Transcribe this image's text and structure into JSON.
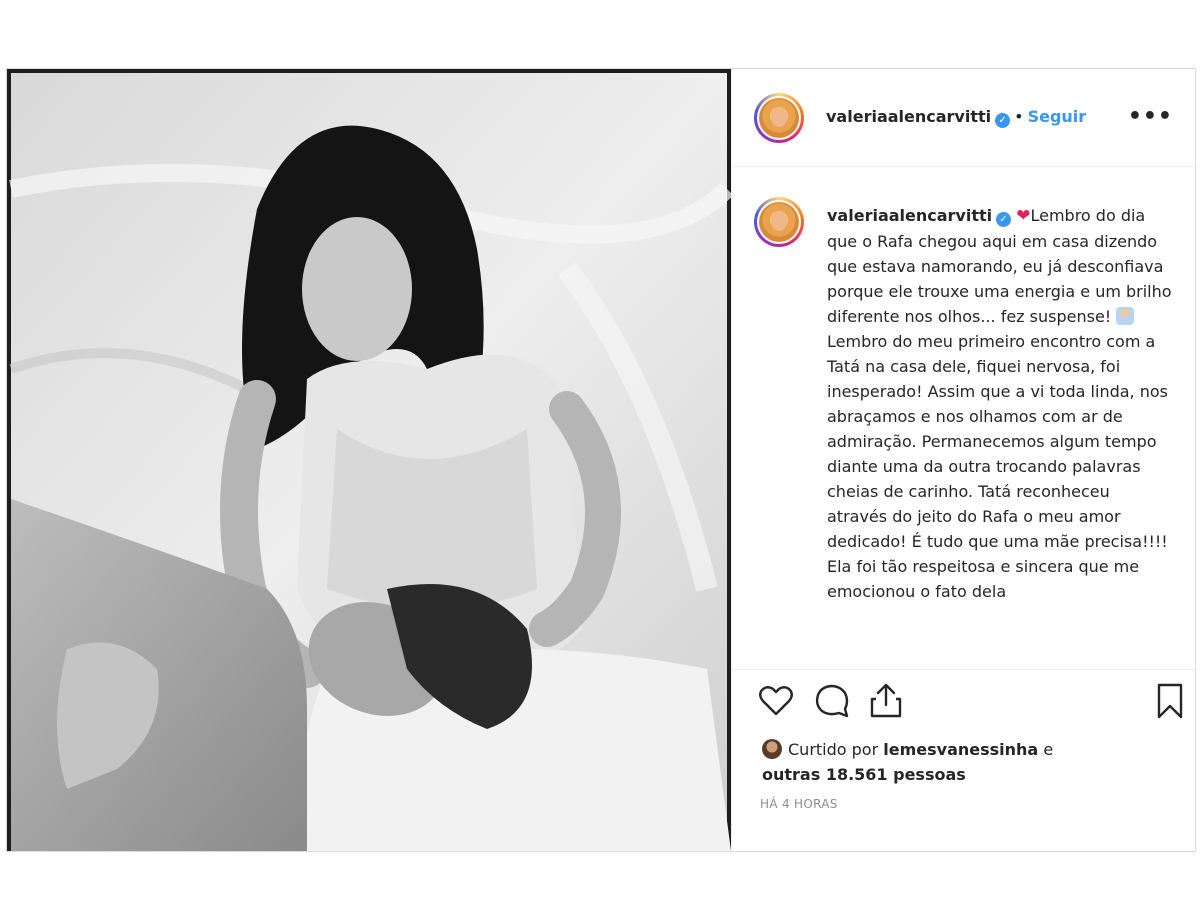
{
  "post": {
    "username": "valeriaalencarvitti",
    "dot": "•",
    "follow_label": "Seguir",
    "more_label": "•••"
  },
  "caption": {
    "username": "valeriaalencarvitti",
    "heart": "❤",
    "line_a": "Lembro do dia que o Rafa chegou aqui em casa dizendo que estava namorando, eu já desconfiava porque ele trouxe uma energia e um brilho diferente nos olhos... fez suspense!",
    "line_b": "Lembro do meu primeiro encontro com a Tatá na casa dele, fiquei nervosa, foi inesperado! Assim que a vi toda linda, nos abraçamos e nos olhamos com ar de admiração. Permanecemos algum tempo diante uma da outra trocando palavras cheias de carinho. Tatá reconheceu através do jeito do Rafa o meu amor dedicado! É tudo que uma mãe precisa!!!! Ela foi tão respeitosa e sincera que me emocionou o fato dela"
  },
  "likes": {
    "prefix": "Curtido por",
    "user": "lemesvanessinha",
    "conj": "e",
    "others": "outras 18.561 pessoas"
  },
  "timestamp": "HÁ 4 HORAS",
  "icons": {
    "like": "heart-outline-icon",
    "comment": "comment-bubble-icon",
    "share": "share-upload-icon",
    "save": "bookmark-icon",
    "verified": "verified-badge-icon",
    "more": "more-options-icon"
  }
}
